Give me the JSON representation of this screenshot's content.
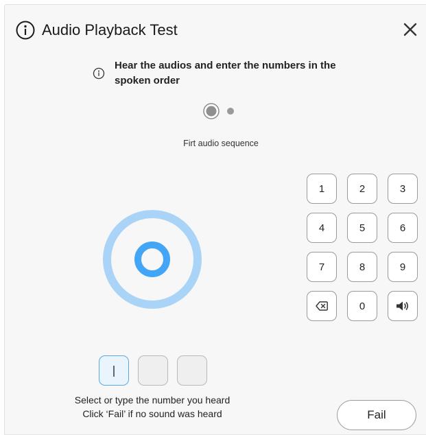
{
  "dialog": {
    "title": "Audio Playback Test",
    "title_icon": "info-icon",
    "close_icon": "close-icon"
  },
  "instruction": {
    "icon": "info-icon",
    "text": "Hear the audios and enter the numbers in the spoken order"
  },
  "sequence": {
    "label": "Firt audio sequence",
    "total": 2,
    "current": 1
  },
  "keypad": {
    "keys": [
      {
        "label": "1",
        "name": "key-1-button"
      },
      {
        "label": "2",
        "name": "key-2-button"
      },
      {
        "label": "3",
        "name": "key-3-button"
      },
      {
        "label": "4",
        "name": "key-4-button"
      },
      {
        "label": "5",
        "name": "key-5-button"
      },
      {
        "label": "6",
        "name": "key-6-button"
      },
      {
        "label": "7",
        "name": "key-7-button"
      },
      {
        "label": "8",
        "name": "key-8-button"
      },
      {
        "label": "9",
        "name": "key-9-button"
      },
      {
        "label": "",
        "name": "backspace-button",
        "icon": "backspace-icon"
      },
      {
        "label": "0",
        "name": "key-0-button"
      },
      {
        "label": "",
        "name": "replay-audio-button",
        "icon": "speaker-icon"
      }
    ]
  },
  "answer": {
    "slots": [
      "",
      "",
      ""
    ],
    "active_slot": 1
  },
  "hint": {
    "line1": "Select or type the number you heard",
    "line2": "Click ‘Fail’ if no sound was heard"
  },
  "actions": {
    "fail_label": "Fail"
  },
  "colors": {
    "accent_blue": "#42a5f5",
    "ring_light_blue": "#a9d4f7",
    "dialog_background": "#f7f7f7"
  }
}
